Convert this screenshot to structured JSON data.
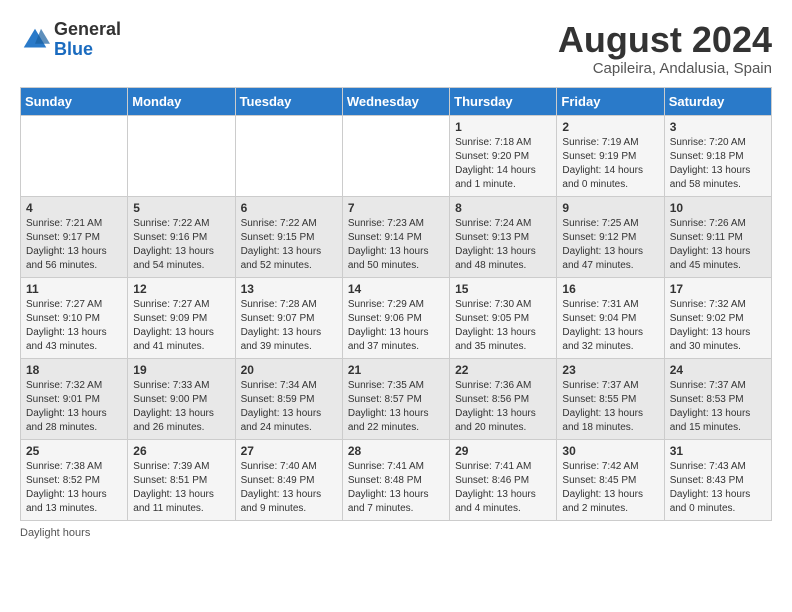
{
  "header": {
    "logo_general": "General",
    "logo_blue": "Blue",
    "month_year": "August 2024",
    "location": "Capileira, Andalusia, Spain"
  },
  "weekdays": [
    "Sunday",
    "Monday",
    "Tuesday",
    "Wednesday",
    "Thursday",
    "Friday",
    "Saturday"
  ],
  "footer_text": "Daylight hours",
  "weeks": [
    [
      {
        "day": "",
        "info": ""
      },
      {
        "day": "",
        "info": ""
      },
      {
        "day": "",
        "info": ""
      },
      {
        "day": "",
        "info": ""
      },
      {
        "day": "1",
        "info": "Sunrise: 7:18 AM\nSunset: 9:20 PM\nDaylight: 14 hours and 1 minute."
      },
      {
        "day": "2",
        "info": "Sunrise: 7:19 AM\nSunset: 9:19 PM\nDaylight: 14 hours and 0 minutes."
      },
      {
        "day": "3",
        "info": "Sunrise: 7:20 AM\nSunset: 9:18 PM\nDaylight: 13 hours and 58 minutes."
      }
    ],
    [
      {
        "day": "4",
        "info": "Sunrise: 7:21 AM\nSunset: 9:17 PM\nDaylight: 13 hours and 56 minutes."
      },
      {
        "day": "5",
        "info": "Sunrise: 7:22 AM\nSunset: 9:16 PM\nDaylight: 13 hours and 54 minutes."
      },
      {
        "day": "6",
        "info": "Sunrise: 7:22 AM\nSunset: 9:15 PM\nDaylight: 13 hours and 52 minutes."
      },
      {
        "day": "7",
        "info": "Sunrise: 7:23 AM\nSunset: 9:14 PM\nDaylight: 13 hours and 50 minutes."
      },
      {
        "day": "8",
        "info": "Sunrise: 7:24 AM\nSunset: 9:13 PM\nDaylight: 13 hours and 48 minutes."
      },
      {
        "day": "9",
        "info": "Sunrise: 7:25 AM\nSunset: 9:12 PM\nDaylight: 13 hours and 47 minutes."
      },
      {
        "day": "10",
        "info": "Sunrise: 7:26 AM\nSunset: 9:11 PM\nDaylight: 13 hours and 45 minutes."
      }
    ],
    [
      {
        "day": "11",
        "info": "Sunrise: 7:27 AM\nSunset: 9:10 PM\nDaylight: 13 hours and 43 minutes."
      },
      {
        "day": "12",
        "info": "Sunrise: 7:27 AM\nSunset: 9:09 PM\nDaylight: 13 hours and 41 minutes."
      },
      {
        "day": "13",
        "info": "Sunrise: 7:28 AM\nSunset: 9:07 PM\nDaylight: 13 hours and 39 minutes."
      },
      {
        "day": "14",
        "info": "Sunrise: 7:29 AM\nSunset: 9:06 PM\nDaylight: 13 hours and 37 minutes."
      },
      {
        "day": "15",
        "info": "Sunrise: 7:30 AM\nSunset: 9:05 PM\nDaylight: 13 hours and 35 minutes."
      },
      {
        "day": "16",
        "info": "Sunrise: 7:31 AM\nSunset: 9:04 PM\nDaylight: 13 hours and 32 minutes."
      },
      {
        "day": "17",
        "info": "Sunrise: 7:32 AM\nSunset: 9:02 PM\nDaylight: 13 hours and 30 minutes."
      }
    ],
    [
      {
        "day": "18",
        "info": "Sunrise: 7:32 AM\nSunset: 9:01 PM\nDaylight: 13 hours and 28 minutes."
      },
      {
        "day": "19",
        "info": "Sunrise: 7:33 AM\nSunset: 9:00 PM\nDaylight: 13 hours and 26 minutes."
      },
      {
        "day": "20",
        "info": "Sunrise: 7:34 AM\nSunset: 8:59 PM\nDaylight: 13 hours and 24 minutes."
      },
      {
        "day": "21",
        "info": "Sunrise: 7:35 AM\nSunset: 8:57 PM\nDaylight: 13 hours and 22 minutes."
      },
      {
        "day": "22",
        "info": "Sunrise: 7:36 AM\nSunset: 8:56 PM\nDaylight: 13 hours and 20 minutes."
      },
      {
        "day": "23",
        "info": "Sunrise: 7:37 AM\nSunset: 8:55 PM\nDaylight: 13 hours and 18 minutes."
      },
      {
        "day": "24",
        "info": "Sunrise: 7:37 AM\nSunset: 8:53 PM\nDaylight: 13 hours and 15 minutes."
      }
    ],
    [
      {
        "day": "25",
        "info": "Sunrise: 7:38 AM\nSunset: 8:52 PM\nDaylight: 13 hours and 13 minutes."
      },
      {
        "day": "26",
        "info": "Sunrise: 7:39 AM\nSunset: 8:51 PM\nDaylight: 13 hours and 11 minutes."
      },
      {
        "day": "27",
        "info": "Sunrise: 7:40 AM\nSunset: 8:49 PM\nDaylight: 13 hours and 9 minutes."
      },
      {
        "day": "28",
        "info": "Sunrise: 7:41 AM\nSunset: 8:48 PM\nDaylight: 13 hours and 7 minutes."
      },
      {
        "day": "29",
        "info": "Sunrise: 7:41 AM\nSunset: 8:46 PM\nDaylight: 13 hours and 4 minutes."
      },
      {
        "day": "30",
        "info": "Sunrise: 7:42 AM\nSunset: 8:45 PM\nDaylight: 13 hours and 2 minutes."
      },
      {
        "day": "31",
        "info": "Sunrise: 7:43 AM\nSunset: 8:43 PM\nDaylight: 13 hours and 0 minutes."
      }
    ]
  ]
}
